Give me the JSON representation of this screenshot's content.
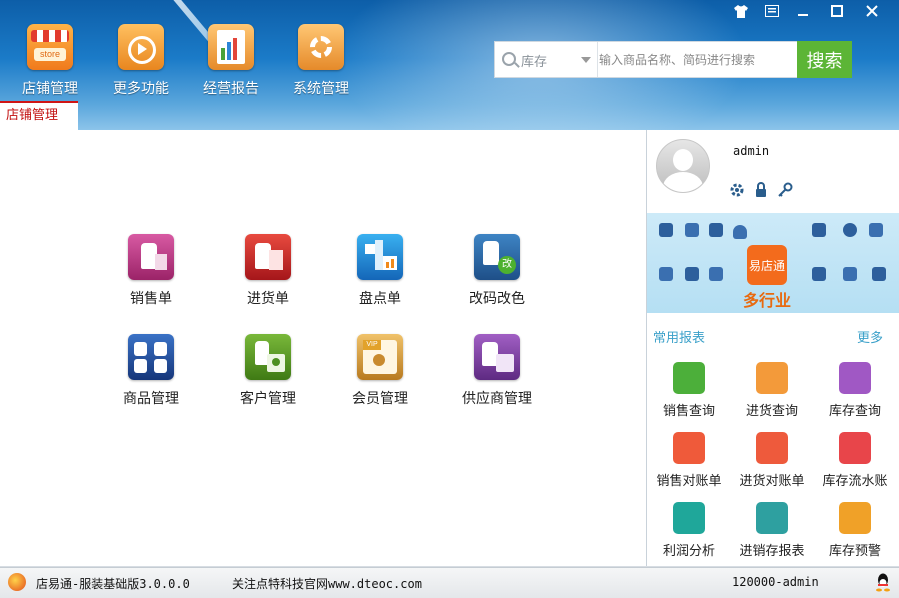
{
  "window_controls": [
    "shirt-icon",
    "menu-icon",
    "minimize-icon",
    "maximize-icon",
    "close-icon"
  ],
  "toolbar": [
    {
      "label": "店铺管理",
      "icon": "store-icon",
      "icon_text": "store"
    },
    {
      "label": "更多功能",
      "icon": "tools-icon"
    },
    {
      "label": "经营报告",
      "icon": "report-icon"
    },
    {
      "label": "系统管理",
      "icon": "system-icon"
    }
  ],
  "search": {
    "category": "库存",
    "placeholder": "输入商品名称、简码进行搜索",
    "button_label": "搜索"
  },
  "tab": {
    "label": "店铺管理"
  },
  "functions": [
    {
      "label": "销售单",
      "icon": "sales-order-icon",
      "color": "#b5327e"
    },
    {
      "label": "进货单",
      "icon": "purchase-order-icon",
      "color": "#c7282b"
    },
    {
      "label": "盘点单",
      "icon": "inventory-count-icon",
      "color": "#1a87d6"
    },
    {
      "label": "改码改色",
      "icon": "change-code-icon",
      "color": "#2d6aa8",
      "badge": "改"
    },
    {
      "label": "商品管理",
      "icon": "product-icon",
      "color": "#254f9c"
    },
    {
      "label": "客户管理",
      "icon": "customer-icon",
      "color": "#5d9a26"
    },
    {
      "label": "会员管理",
      "icon": "member-icon",
      "color": "#c98a2e",
      "badge": "VIP"
    },
    {
      "label": "供应商管理",
      "icon": "supplier-icon",
      "color": "#7a3e9a"
    }
  ],
  "user": {
    "name": "admin"
  },
  "user_actions": [
    "settings-icon",
    "lock-icon",
    "key-icon"
  ],
  "banner": {
    "center": "易店通",
    "tagline": "多行业"
  },
  "reports": {
    "title": "常用报表",
    "more": "更多",
    "items": [
      {
        "label": "销售查询",
        "icon": "sales-query-icon",
        "color": "#4caf3a"
      },
      {
        "label": "进货查询",
        "icon": "purchase-query-icon",
        "color": "#f39a3a"
      },
      {
        "label": "库存查询",
        "icon": "stock-query-icon",
        "color": "#a058c4"
      },
      {
        "label": "销售对账单",
        "icon": "sales-statement-icon",
        "color": "#ef5a3a"
      },
      {
        "label": "进货对账单",
        "icon": "purchase-statement-icon",
        "color": "#ee5a3c"
      },
      {
        "label": "库存流水账",
        "icon": "stock-ledger-icon",
        "color": "#e8454a"
      },
      {
        "label": "利润分析",
        "icon": "profit-icon",
        "color": "#1fa79a"
      },
      {
        "label": "进销存报表",
        "icon": "inout-report-icon",
        "color": "#2ea0a0"
      },
      {
        "label": "库存预警",
        "icon": "stock-alert-icon",
        "color": "#f0a128"
      }
    ]
  },
  "footer": {
    "product": "店易通-服装基础版3.0.0.0",
    "notice": "关注点特科技官网www.dteoc.com",
    "account": "120000-admin"
  }
}
